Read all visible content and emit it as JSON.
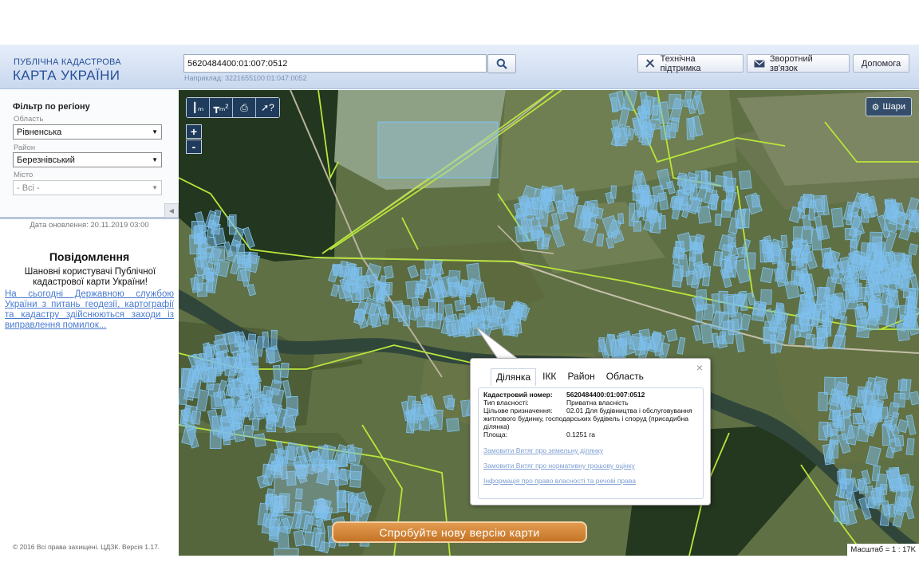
{
  "header": {
    "logo_small": "ПУБЛІЧНА КАДАСТРОВА",
    "logo_big": "КАРТА УКРАЇНИ",
    "search_value": "5620484400:01:007:0512",
    "search_hint": "Наприклад: 3221655100:01:047:0052",
    "search_icon": "search-icon",
    "support_label": "Технічна підтримка",
    "feedback_label": "Зворотний зв'язок",
    "help_label": "Допомога"
  },
  "sidebar": {
    "filter_title": "Фільтр по регіону",
    "oblast_label": "Область",
    "oblast_value": "Рівненська",
    "raion_label": "Район",
    "raion_value": "Березнівський",
    "misto_label": "Місто",
    "misto_value": "- Всі -",
    "update_date": "Дата оновлення: 20.11.2019 03:00",
    "message_title": "Повідомлення",
    "message_text": "Шановні користувачі Публічної кадастрової карти України!",
    "message_link": "На сьогодні Державною службою України з питань геодезії, картографії та кадастру здійснюються заходи із виправлення помилок...",
    "copyright": "© 2016 Всі права захищені. ЦДЗК. Версія 1.17."
  },
  "map": {
    "zoom_in": "+",
    "zoom_out": "-",
    "layers_label": "Шари",
    "new_version_label": "Спробуйте нову версію карти",
    "scale": "Масштаб = 1 : 17K",
    "tools": [
      "ruler-icon",
      "area-measure-icon",
      "print-icon",
      "pointer-help-icon"
    ]
  },
  "popup": {
    "tabs": [
      "Ділянка",
      "ІКК",
      "Район",
      "Область"
    ],
    "close": "×",
    "cad_key": "Кадастровий номер:",
    "cad_value": "5620484400:01:007:0512",
    "ownership_key": "Тип власності:",
    "ownership_value": "Приватна власність",
    "purpose_key": "Цільове призначення:",
    "purpose_value": "02.01 Для будівництва і обслуговування житлового будинку, господарських будівель і споруд (присадибна ділянка)",
    "area_key": "Площа:",
    "area_value": "0.1251 га",
    "link1": "Замовити Витяг про земельну ділянку",
    "link2": "Замовити Витяг про нормативну грошову оцінку",
    "link3": "Інформація про право власності та речові права"
  }
}
